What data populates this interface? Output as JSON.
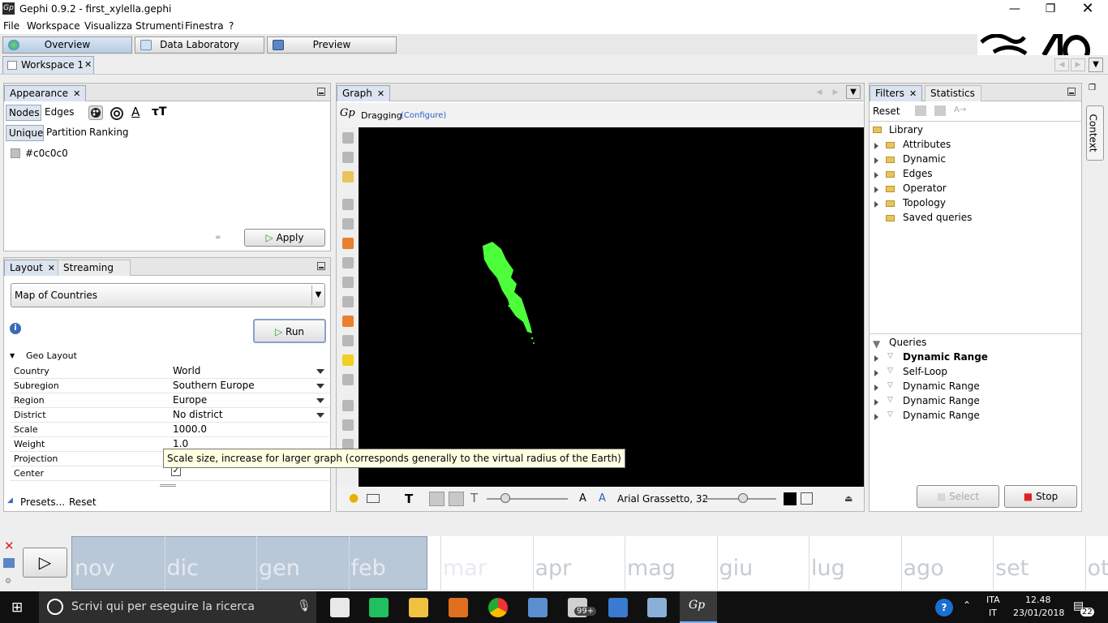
{
  "window": {
    "title": "Gephi 0.9.2 - first_xylella.gephi",
    "app_icon_text": "Gp"
  },
  "menu": [
    "File",
    "Workspace",
    "Visualizza",
    "Strumenti",
    "Finestra",
    "?"
  ],
  "toolbar": {
    "overview": "Overview",
    "data_laboratory": "Data Laboratory",
    "preview": "Preview"
  },
  "workspace_tab": "Workspace 1",
  "appearance": {
    "tab": "Appearance",
    "element_tabs": [
      "Nodes",
      "Edges"
    ],
    "mode_tabs": [
      "Unique",
      "Partition",
      "Ranking"
    ],
    "color_value": "#c0c0c0",
    "node_color": "#c0c0c0",
    "apply_label": "Apply"
  },
  "layout": {
    "tabs": [
      "Layout",
      "Streaming"
    ],
    "selected": "Map of Countries",
    "run_label": "Run",
    "section": "Geo Layout",
    "properties": [
      {
        "key": "Country",
        "value": "World",
        "dropdown": true
      },
      {
        "key": "Subregion",
        "value": "Southern Europe",
        "dropdown": true
      },
      {
        "key": "Region",
        "value": "Europe",
        "dropdown": true
      },
      {
        "key": "District",
        "value": "No district",
        "dropdown": true
      },
      {
        "key": "Scale",
        "value": "1000.0",
        "dropdown": false
      },
      {
        "key": "Weight",
        "value": "1.0",
        "dropdown": false
      },
      {
        "key": "Projection",
        "value": "",
        "dropdown": false
      },
      {
        "key": "Center",
        "value": "",
        "dropdown": false
      }
    ],
    "tooltip": "Scale size, increase for larger graph (corresponds generally to the virtual radius of the Earth)",
    "presets_label": "Presets...",
    "reset_label": "Reset"
  },
  "graph": {
    "tab": "Graph",
    "mode": "Dragging",
    "configure": "(Configure)",
    "font_label": "Arial Grassetto, 32",
    "graph_color": "#4cff3a",
    "background": "#000000"
  },
  "filters": {
    "tabs": [
      "Filters",
      "Statistics"
    ],
    "reset_label": "Reset",
    "library_label": "Library",
    "library": [
      "Attributes",
      "Dynamic",
      "Edges",
      "Operator",
      "Topology",
      "Saved queries"
    ],
    "queries_label": "Queries",
    "queries": [
      "Dynamic Range",
      "Self-Loop",
      "Dynamic Range",
      "Dynamic Range",
      "Dynamic Range"
    ],
    "select_label": "Select",
    "stop_label": "Stop"
  },
  "context_label": "Context",
  "timeline": {
    "months": [
      "nov",
      "dic",
      "gen",
      "feb",
      "mar",
      "apr",
      "mag",
      "giu",
      "lug",
      "ago",
      "set",
      "ott"
    ]
  },
  "taskbar": {
    "search_placeholder": "Scrivi qui per eseguire la ricerca",
    "mail_badge": "99+",
    "lang1": "ITA",
    "lang2": "IT",
    "time": "12.48",
    "date": "23/01/2018",
    "notif": "22"
  }
}
